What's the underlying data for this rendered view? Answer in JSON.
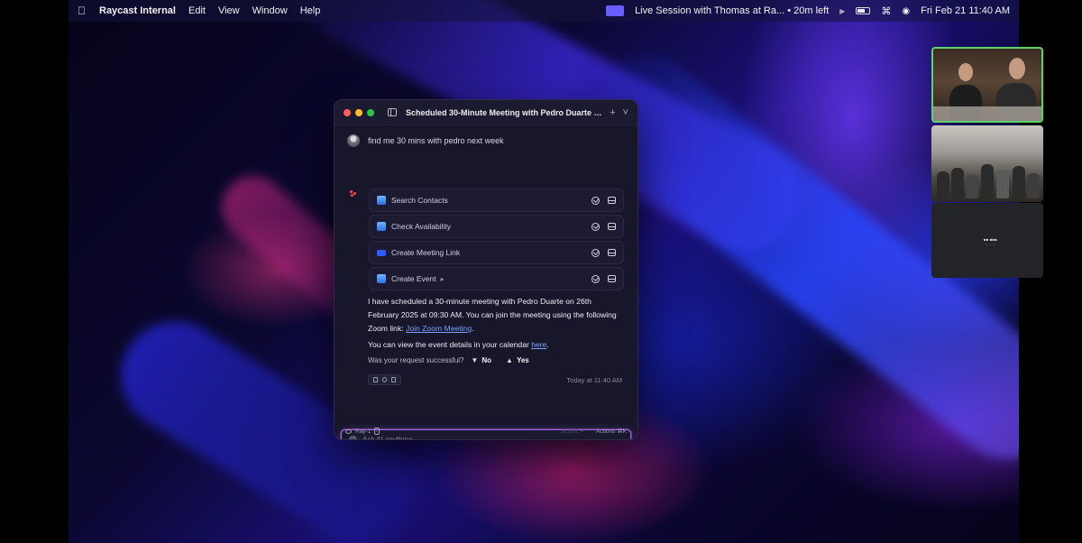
{
  "menubar": {
    "app_name": "Raycast Internal",
    "menus": [
      "Edit",
      "View",
      "Window",
      "Help"
    ],
    "live_session": "Live Session with Thomas at Ra... • 20m left",
    "clock": "Fri Feb 21  11:40 AM"
  },
  "window": {
    "title": "Scheduled 30-Minute Meeting with Pedro Duarte Next...",
    "new_label": "+",
    "dropdown_label": "˅"
  },
  "chat": {
    "user_message": "find me 30 mins with pedro next week",
    "tools": [
      {
        "label": "Search Contacts",
        "icon": "calendar-icon"
      },
      {
        "label": "Check Availability",
        "icon": "calendar-icon"
      },
      {
        "label": "Create Meeting Link",
        "icon": "zoom-icon"
      },
      {
        "label": "Create Event",
        "icon": "calendar-icon",
        "expandable": true
      }
    ],
    "response_1_a": "I have scheduled a 30-minute meeting with Pedro Duarte on 26th February 2025 at 09:30 AM. You can join the meeting using the following Zoom link: ",
    "response_1_link": "Join Zoom Meeting",
    "response_1_end": ".",
    "response_2_a": "You can view the event details in your calendar ",
    "response_2_link": "here",
    "response_2_end": ".",
    "feedback_question": "Was your request successful?",
    "feedback_no": "No",
    "feedback_yes": "Yes",
    "timestamp": "Today at 11:40 AM"
  },
  "composer": {
    "placeholder": "Ask AI anything..."
  },
  "footer": {
    "model": "Ray-1",
    "faint_hint": "Submit ↵",
    "actions": "Actions ⌘K"
  },
  "colors": {
    "accent": "#8a6cff",
    "link": "#7aa4ff",
    "active_speaker": "#5fd36a"
  }
}
